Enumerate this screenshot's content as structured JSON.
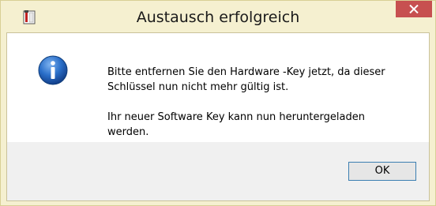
{
  "window": {
    "title": "Austausch erfolgreich",
    "app_icon": "application-icon",
    "close_icon": "close-icon"
  },
  "dialog": {
    "icon": "info-icon",
    "message_line1a": "Bitte entfernen Sie den Hardware -Key jetzt, da dieser",
    "message_line1b": "Schlüssel nun nicht mehr gültig ist.",
    "message_line2a": "Ihr neuer Software Key kann nun heruntergeladen",
    "message_line2b": "werden.",
    "ok_label": "OK"
  },
  "colors": {
    "titlebar": "#f5f0d0",
    "close_button": "#c75050",
    "info_icon": "#1f5fb8",
    "button_border": "#3c7fb1"
  }
}
